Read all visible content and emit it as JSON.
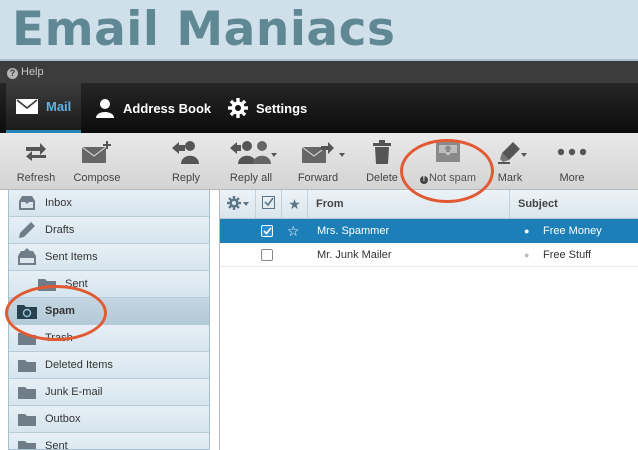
{
  "banner": {
    "title": "Email Maniacs"
  },
  "helpbar": {
    "label": "Help"
  },
  "nav": {
    "mail": "Mail",
    "address_book": "Address Book",
    "settings": "Settings"
  },
  "toolbar": {
    "refresh": "Refresh",
    "compose": "Compose",
    "reply": "Reply",
    "reply_all": "Reply all",
    "forward": "Forward",
    "delete": "Delete",
    "not_spam": "Not spam",
    "mark": "Mark",
    "more": "More"
  },
  "folders": [
    {
      "label": "Inbox",
      "icon": "inbox-icon"
    },
    {
      "label": "Drafts",
      "icon": "pencil-icon"
    },
    {
      "label": "Sent Items",
      "icon": "sent-items-icon"
    },
    {
      "label": "Sent",
      "icon": "folder-icon"
    },
    {
      "label": "Spam",
      "icon": "spam-folder-icon"
    },
    {
      "label": "Trash",
      "icon": "trash-icon"
    },
    {
      "label": "Deleted Items",
      "icon": "folder-icon"
    },
    {
      "label": "Junk E-mail",
      "icon": "folder-icon"
    },
    {
      "label": "Outbox",
      "icon": "folder-icon"
    },
    {
      "label": "Sent",
      "icon": "folder-icon"
    }
  ],
  "list": {
    "columns": {
      "from": "From",
      "subject": "Subject"
    },
    "rows": [
      {
        "from": "Mrs. Spammer",
        "subject": "Free Money",
        "selected": true
      },
      {
        "from": "Mr. Junk Mailer",
        "subject": "Free Stuff",
        "selected": false
      }
    ]
  },
  "colors": {
    "accent": "#1d7fb8",
    "annotation": "#e25a33",
    "banner_text": "#5f8894"
  }
}
